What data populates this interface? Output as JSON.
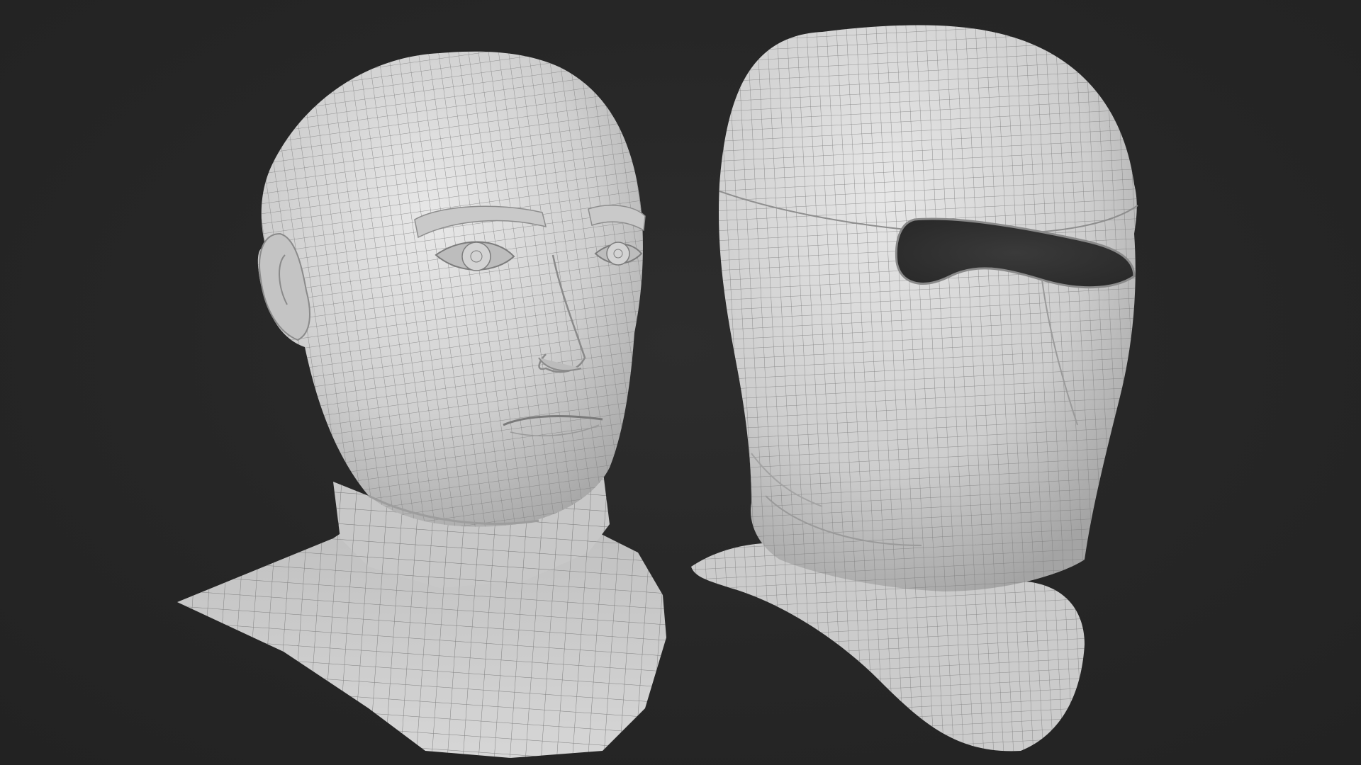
{
  "scene": {
    "background_color": "#262626",
    "mesh_fill_color": "#d9d9d9",
    "wire_color": "#6f6f6f",
    "shadow_color": "#9a9a9a",
    "objects": [
      {
        "name": "wireframe-female-head-bust"
      },
      {
        "name": "wireframe-balaclava-mask"
      }
    ]
  }
}
